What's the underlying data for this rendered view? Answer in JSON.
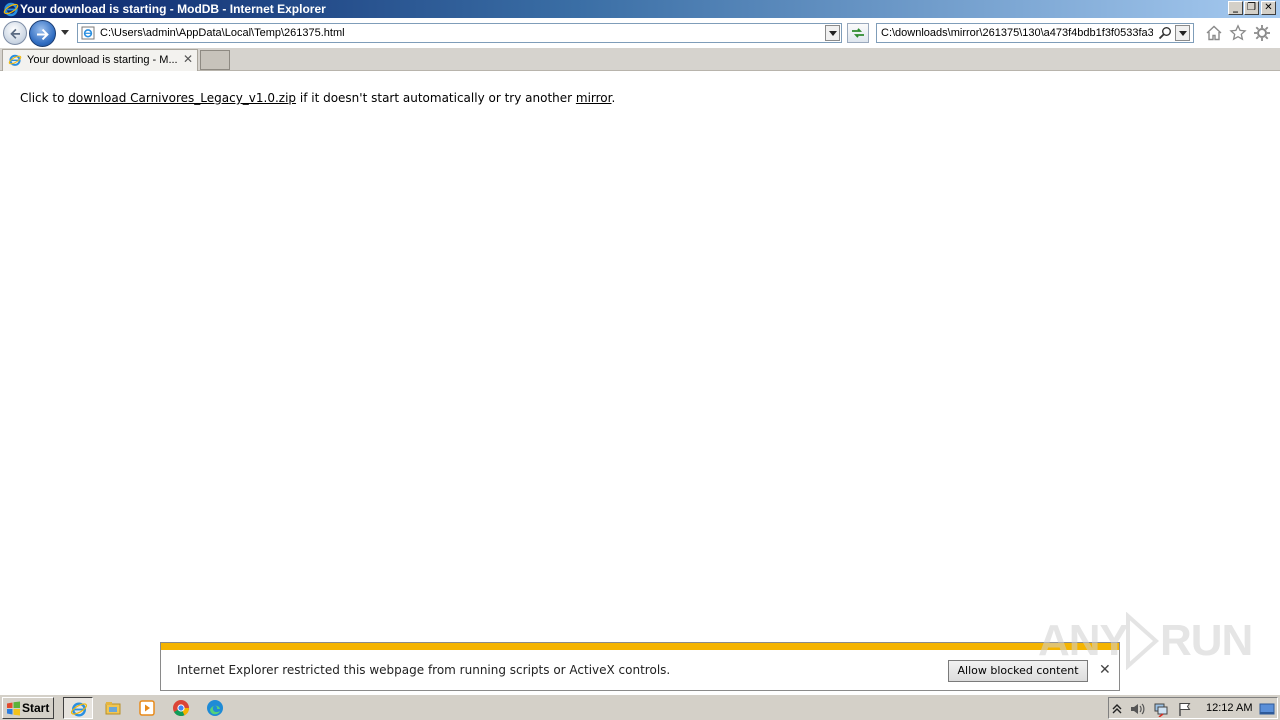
{
  "window": {
    "title": "Your download is starting - ModDB - Internet Explorer",
    "controls": {
      "minimize": "_",
      "restore": "❐",
      "close": "✕"
    }
  },
  "navbar": {
    "address": "C:\\Users\\admin\\AppData\\Local\\Temp\\261375.html",
    "search_value": "C:\\downloads\\mirror\\261375\\130\\a473f4bdb1f3f0533fa3",
    "icons": [
      "back-icon",
      "forward-icon",
      "recent-pages-icon",
      "page-icon",
      "address-dropdown-icon",
      "compatibility-refresh-icon",
      "search-icon",
      "search-dropdown-icon",
      "home-icon",
      "favorites-icon",
      "tools-icon"
    ]
  },
  "tabs": [
    {
      "label": "Your download is starting - M...",
      "close": "✕",
      "active": true
    }
  ],
  "content": {
    "prefix": "Click to ",
    "download_link": "download Carnivores_Legacy_v1.0.zip",
    "middle": " if it doesn't start automatically or try another ",
    "mirror_link": "mirror",
    "suffix": "."
  },
  "infobar": {
    "message": "Internet Explorer restricted this webpage from running scripts or ActiveX controls.",
    "button": "Allow blocked content",
    "close": "✕",
    "accent": "#f5b400"
  },
  "taskbar": {
    "start_label": "Start",
    "apps": [
      "internet-explorer-icon",
      "file-explorer-icon",
      "media-player-icon",
      "chrome-icon",
      "edge-icon"
    ],
    "clock": "12:12 AM",
    "tray_icons": [
      "show-hidden-icons",
      "volume-icon",
      "network-icon",
      "action-center-flag-icon",
      "show-desktop-icon"
    ]
  },
  "colors": {
    "titlebar_start": "#0a246a",
    "titlebar_end": "#a6caf0",
    "taskbar": "#d4d0c8"
  }
}
